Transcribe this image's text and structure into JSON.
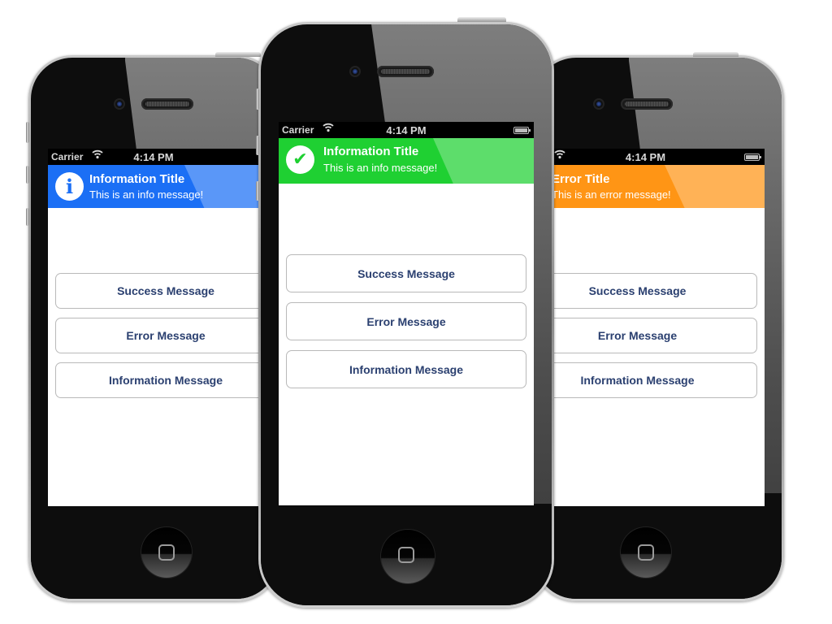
{
  "statusbar": {
    "carrier": "Carrier",
    "wifi_icon": "◔",
    "time": "4:14 PM"
  },
  "phones": [
    {
      "position": "left",
      "banner": {
        "type": "info",
        "icon": "info-icon",
        "icon_glyph": "i",
        "title": "Information Title",
        "message": "This is an info message!",
        "color": "#1b6ff5"
      },
      "buttons": [
        "Success Message",
        "Error Message",
        "Information Message"
      ]
    },
    {
      "position": "center",
      "banner": {
        "type": "success",
        "icon": "checkmark-icon",
        "icon_glyph": "✔",
        "title": "Information Title",
        "message": "This is an info message!",
        "color": "#1fd032"
      },
      "buttons": [
        "Success Message",
        "Error Message",
        "Information Message"
      ]
    },
    {
      "position": "right",
      "banner": {
        "type": "error",
        "icon": "error-icon",
        "icon_glyph": "!",
        "title": "Error Title",
        "message": "This is an error message!",
        "color": "#ff9515"
      },
      "buttons": [
        "Success Message",
        "Error Message",
        "Information Message"
      ]
    }
  ],
  "colors": {
    "button_text": "#2b4070",
    "button_border": "#b9b9b9"
  }
}
